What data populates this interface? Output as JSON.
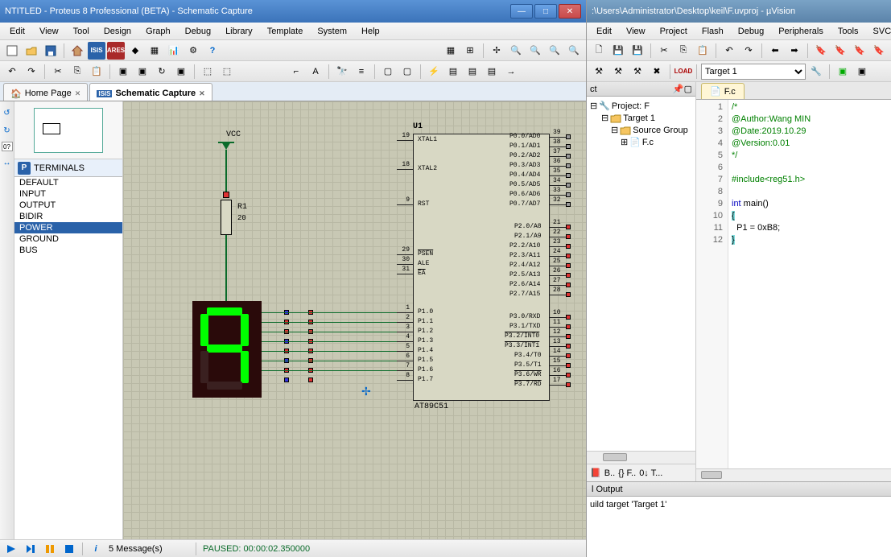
{
  "proteus": {
    "title": "NTITLED - Proteus 8 Professional (BETA) - Schematic Capture",
    "menus": [
      "Edit",
      "View",
      "Tool",
      "Design",
      "Graph",
      "Debug",
      "Library",
      "Template",
      "System",
      "Help"
    ],
    "tabs": [
      {
        "label": "Home Page",
        "active": false
      },
      {
        "label": "Schematic Capture",
        "active": true
      }
    ],
    "terminals_header": "TERMINALS",
    "terminals": [
      "DEFAULT",
      "INPUT",
      "OUTPUT",
      "BIDIR",
      "POWER",
      "GROUND",
      "BUS"
    ],
    "terminals_selected": "POWER",
    "schematic": {
      "vcc_label": "VCC",
      "r1_name": "R1",
      "r1_value": "20",
      "chip_ref": "U1",
      "chip_part": "AT89C51",
      "left_pins": [
        {
          "num": "19",
          "name": "XTAL1"
        },
        {
          "num": "18",
          "name": "XTAL2"
        },
        {
          "num": "9",
          "name": "RST"
        },
        {
          "num": "29",
          "name": "PSEN",
          "bar": true
        },
        {
          "num": "30",
          "name": "ALE"
        },
        {
          "num": "31",
          "name": "EA",
          "bar": true
        },
        {
          "num": "1",
          "name": "P1.0"
        },
        {
          "num": "2",
          "name": "P1.1"
        },
        {
          "num": "3",
          "name": "P1.2"
        },
        {
          "num": "4",
          "name": "P1.3"
        },
        {
          "num": "5",
          "name": "P1.4"
        },
        {
          "num": "6",
          "name": "P1.5"
        },
        {
          "num": "7",
          "name": "P1.6"
        },
        {
          "num": "8",
          "name": "P1.7"
        }
      ],
      "right_pins": [
        {
          "num": "39",
          "name": "P0.0/AD0"
        },
        {
          "num": "38",
          "name": "P0.1/AD1"
        },
        {
          "num": "37",
          "name": "P0.2/AD2"
        },
        {
          "num": "36",
          "name": "P0.3/AD3"
        },
        {
          "num": "35",
          "name": "P0.4/AD4"
        },
        {
          "num": "34",
          "name": "P0.5/AD5"
        },
        {
          "num": "33",
          "name": "P0.6/AD6"
        },
        {
          "num": "32",
          "name": "P0.7/AD7"
        },
        {
          "num": "21",
          "name": "P2.0/A8"
        },
        {
          "num": "22",
          "name": "P2.1/A9"
        },
        {
          "num": "23",
          "name": "P2.2/A10"
        },
        {
          "num": "24",
          "name": "P2.3/A11"
        },
        {
          "num": "25",
          "name": "P2.4/A12"
        },
        {
          "num": "26",
          "name": "P2.5/A13"
        },
        {
          "num": "27",
          "name": "P2.6/A14"
        },
        {
          "num": "28",
          "name": "P2.7/A15"
        },
        {
          "num": "10",
          "name": "P3.0/RXD"
        },
        {
          "num": "11",
          "name": "P3.1/TXD"
        },
        {
          "num": "12",
          "name": "P3.2/INT0",
          "bar": true
        },
        {
          "num": "13",
          "name": "P3.3/INT1",
          "bar": true
        },
        {
          "num": "14",
          "name": "P3.4/T0"
        },
        {
          "num": "15",
          "name": "P3.5/T1"
        },
        {
          "num": "16",
          "name": "P3.6/WR",
          "bar": true
        },
        {
          "num": "17",
          "name": "P3.7/RD",
          "bar": true
        }
      ]
    },
    "status": {
      "messages": "5 Message(s)",
      "sim": "PAUSED: 00:00:02.350000"
    }
  },
  "uvision": {
    "title": ":\\Users\\Administrator\\Desktop\\keil\\F.uvproj - µVision",
    "menus": [
      "Edit",
      "View",
      "Project",
      "Flash",
      "Debug",
      "Peripherals",
      "Tools",
      "SVCS"
    ],
    "target_dropdown": "Target 1",
    "project_panel": {
      "pin_label": "ct"
    },
    "tree": {
      "root": "Project: F",
      "target": "Target 1",
      "group": "Source Group",
      "file": "F.c"
    },
    "bottom_tabs": [
      "B..",
      "{} F..",
      "0↓ T..."
    ],
    "file_tab": "F.c",
    "code_lines": [
      {
        "n": 1,
        "t": "/*",
        "cls": "c-green"
      },
      {
        "n": 2,
        "t": "@Author:Wang MIN",
        "cls": "c-green"
      },
      {
        "n": 3,
        "t": "@Date:2019.10.29",
        "cls": "c-green"
      },
      {
        "n": 4,
        "t": "@Version:0.01",
        "cls": "c-green"
      },
      {
        "n": 5,
        "t": "*/",
        "cls": "c-green"
      },
      {
        "n": 6,
        "t": "",
        "cls": ""
      },
      {
        "n": 7,
        "t": "#include<reg51.h>",
        "cls": "c-green"
      },
      {
        "n": 8,
        "t": "",
        "cls": ""
      },
      {
        "n": 9,
        "t": "int main()",
        "cls": "c-blue",
        "plain": "int main()"
      },
      {
        "n": 10,
        "t": "{",
        "cls": "",
        "hl": true
      },
      {
        "n": 11,
        "t": "  P1 = 0xB8;",
        "cls": ""
      },
      {
        "n": 12,
        "t": "}",
        "cls": "",
        "hl": true
      }
    ],
    "output": {
      "header": "l Output",
      "text": "uild target 'Target 1'"
    }
  }
}
